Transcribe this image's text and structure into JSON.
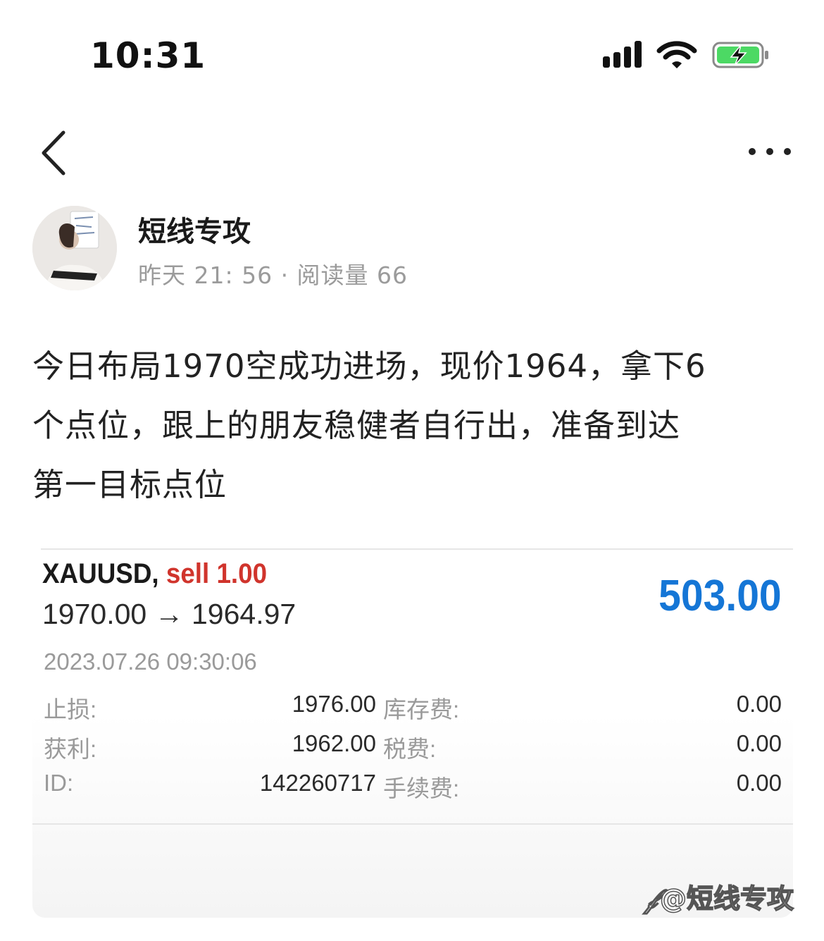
{
  "status_bar": {
    "time": "10:31",
    "icons": [
      "signal-icon",
      "wifi-icon",
      "battery-charging-icon"
    ],
    "battery_color": "#4cd964"
  },
  "nav": {
    "back_icon": "chevron-left-icon",
    "more_icon": "more-horizontal-icon"
  },
  "author": {
    "name": "短线专攻",
    "meta": "昨天 21: 56 · 阅读量 66"
  },
  "post": {
    "lines": [
      "今日布局1970空成功进场，现价1964，拿下6",
      "个点位，跟上的朋友稳健者自行出，准备到达",
      "第一目标点位"
    ]
  },
  "trade": {
    "symbol": "XAUUSD,",
    "side": "sell 1.00",
    "price_range": "1970.00 → 1964.97",
    "profit": "503.00",
    "time": "2023.07.26 09:30:06",
    "rows": [
      {
        "label": "止损:",
        "value": "1976.00",
        "label2": "库存费:",
        "value2": "0.00"
      },
      {
        "label": "获利:",
        "value": "1962.00",
        "label2": "税费:",
        "value2": "0.00"
      },
      {
        "label": "ID:",
        "value": "142260717",
        "label2": "手续费:",
        "value2": "0.00"
      }
    ],
    "colors": {
      "sell": "#d0342c",
      "profit": "#1576d6"
    }
  },
  "watermark": {
    "text": "@短线专攻"
  }
}
